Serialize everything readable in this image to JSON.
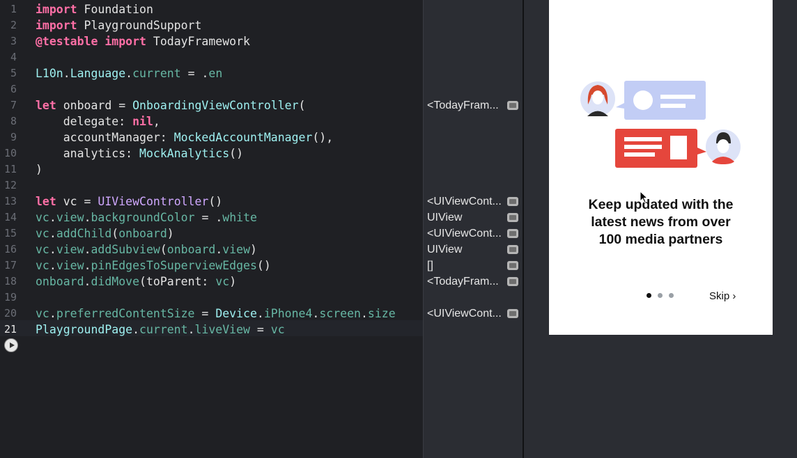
{
  "editor": {
    "lines": [
      {
        "n": "1",
        "tokens": [
          {
            "t": "import",
            "c": "kw"
          },
          {
            "t": " Foundation",
            "c": "pl"
          }
        ]
      },
      {
        "n": "2",
        "tokens": [
          {
            "t": "import",
            "c": "kw"
          },
          {
            "t": " PlaygroundSupport",
            "c": "pl"
          }
        ]
      },
      {
        "n": "3",
        "tokens": [
          {
            "t": "@testable import",
            "c": "kw"
          },
          {
            "t": " TodayFramework",
            "c": "pl"
          }
        ]
      },
      {
        "n": "4",
        "tokens": []
      },
      {
        "n": "5",
        "tokens": [
          {
            "t": "L10n",
            "c": "ty"
          },
          {
            "t": ".",
            "c": "pl"
          },
          {
            "t": "Language",
            "c": "ty"
          },
          {
            "t": ".",
            "c": "pl"
          },
          {
            "t": "current",
            "c": "fn"
          },
          {
            "t": " = .",
            "c": "pl"
          },
          {
            "t": "en",
            "c": "fn"
          }
        ]
      },
      {
        "n": "6",
        "tokens": []
      },
      {
        "n": "7",
        "tokens": [
          {
            "t": "let",
            "c": "kw"
          },
          {
            "t": " onboard = ",
            "c": "pl"
          },
          {
            "t": "OnboardingViewController",
            "c": "ty"
          },
          {
            "t": "(",
            "c": "pl"
          }
        ]
      },
      {
        "n": "8",
        "tokens": [
          {
            "t": "    delegate: ",
            "c": "pl"
          },
          {
            "t": "nil",
            "c": "kw"
          },
          {
            "t": ",",
            "c": "pl"
          }
        ]
      },
      {
        "n": "9",
        "tokens": [
          {
            "t": "    accountManager: ",
            "c": "pl"
          },
          {
            "t": "MockedAccountManager",
            "c": "ty"
          },
          {
            "t": "(),",
            "c": "pl"
          }
        ]
      },
      {
        "n": "10",
        "tokens": [
          {
            "t": "    analytics: ",
            "c": "pl"
          },
          {
            "t": "MockAnalytics",
            "c": "ty"
          },
          {
            "t": "()",
            "c": "pl"
          }
        ]
      },
      {
        "n": "11",
        "tokens": [
          {
            "t": ")",
            "c": "pl"
          }
        ]
      },
      {
        "n": "12",
        "tokens": []
      },
      {
        "n": "13",
        "tokens": [
          {
            "t": "let",
            "c": "kw"
          },
          {
            "t": " vc = ",
            "c": "pl"
          },
          {
            "t": "UIViewController",
            "c": "ty2"
          },
          {
            "t": "()",
            "c": "pl"
          }
        ]
      },
      {
        "n": "14",
        "tokens": [
          {
            "t": "vc",
            "c": "fn"
          },
          {
            "t": ".",
            "c": "pl"
          },
          {
            "t": "view",
            "c": "fn"
          },
          {
            "t": ".",
            "c": "pl"
          },
          {
            "t": "backgroundColor",
            "c": "fn"
          },
          {
            "t": " = .",
            "c": "pl"
          },
          {
            "t": "white",
            "c": "fn"
          }
        ]
      },
      {
        "n": "15",
        "tokens": [
          {
            "t": "vc",
            "c": "fn"
          },
          {
            "t": ".",
            "c": "pl"
          },
          {
            "t": "addChild",
            "c": "fn"
          },
          {
            "t": "(",
            "c": "pl"
          },
          {
            "t": "onboard",
            "c": "fn"
          },
          {
            "t": ")",
            "c": "pl"
          }
        ]
      },
      {
        "n": "16",
        "tokens": [
          {
            "t": "vc",
            "c": "fn"
          },
          {
            "t": ".",
            "c": "pl"
          },
          {
            "t": "view",
            "c": "fn"
          },
          {
            "t": ".",
            "c": "pl"
          },
          {
            "t": "addSubview",
            "c": "fn"
          },
          {
            "t": "(",
            "c": "pl"
          },
          {
            "t": "onboard",
            "c": "fn"
          },
          {
            "t": ".",
            "c": "pl"
          },
          {
            "t": "view",
            "c": "fn"
          },
          {
            "t": ")",
            "c": "pl"
          }
        ]
      },
      {
        "n": "17",
        "tokens": [
          {
            "t": "vc",
            "c": "fn"
          },
          {
            "t": ".",
            "c": "pl"
          },
          {
            "t": "view",
            "c": "fn"
          },
          {
            "t": ".",
            "c": "pl"
          },
          {
            "t": "pinEdgesToSuperviewEdges",
            "c": "fn"
          },
          {
            "t": "()",
            "c": "pl"
          }
        ]
      },
      {
        "n": "18",
        "tokens": [
          {
            "t": "onboard",
            "c": "fn"
          },
          {
            "t": ".",
            "c": "pl"
          },
          {
            "t": "didMove",
            "c": "fn"
          },
          {
            "t": "(toParent: ",
            "c": "pl"
          },
          {
            "t": "vc",
            "c": "fn"
          },
          {
            "t": ")",
            "c": "pl"
          }
        ]
      },
      {
        "n": "19",
        "tokens": []
      },
      {
        "n": "20",
        "tokens": [
          {
            "t": "vc",
            "c": "fn"
          },
          {
            "t": ".",
            "c": "pl"
          },
          {
            "t": "preferredContentSize",
            "c": "fn"
          },
          {
            "t": " = ",
            "c": "pl"
          },
          {
            "t": "Device",
            "c": "ty"
          },
          {
            "t": ".",
            "c": "pl"
          },
          {
            "t": "iPhone4",
            "c": "fn"
          },
          {
            "t": ".",
            "c": "pl"
          },
          {
            "t": "screen",
            "c": "fn"
          },
          {
            "t": ".",
            "c": "pl"
          },
          {
            "t": "size",
            "c": "fn"
          }
        ]
      },
      {
        "n": "21",
        "tokens": [
          {
            "t": "PlaygroundPage",
            "c": "ty"
          },
          {
            "t": ".",
            "c": "pl"
          },
          {
            "t": "current",
            "c": "fn"
          },
          {
            "t": ".",
            "c": "pl"
          },
          {
            "t": "liveView",
            "c": "fn"
          },
          {
            "t": " = ",
            "c": "pl"
          },
          {
            "t": "vc",
            "c": "fn"
          }
        ]
      }
    ]
  },
  "results": [
    {
      "line": "7",
      "text": "<TodayFram...",
      "quicklook": true
    },
    {
      "line": "13",
      "text": "<UIViewCont...",
      "quicklook": true
    },
    {
      "line": "14",
      "text": "UIView",
      "quicklook": true
    },
    {
      "line": "15",
      "text": "<UIViewCont...",
      "quicklook": true
    },
    {
      "line": "16",
      "text": "UIView",
      "quicklook": true
    },
    {
      "line": "17",
      "text": "[]",
      "quicklook": true
    },
    {
      "line": "18",
      "text": "<TodayFram...",
      "quicklook": true
    },
    {
      "line": "20",
      "text": "<UIViewCont...",
      "quicklook": true
    }
  ],
  "live_view": {
    "headline_lines": [
      "Keep updated with the",
      "latest news from over",
      "100 media partners"
    ],
    "page_dots": 3,
    "active_dot": 0,
    "skip_label": "Skip",
    "skip_chevron": "›",
    "colors": {
      "bubble_blue": "#c2cdf5",
      "bubble_red": "#e5463c",
      "avatar_bg": "#dde3f7",
      "hair": "#d64a2e"
    }
  }
}
